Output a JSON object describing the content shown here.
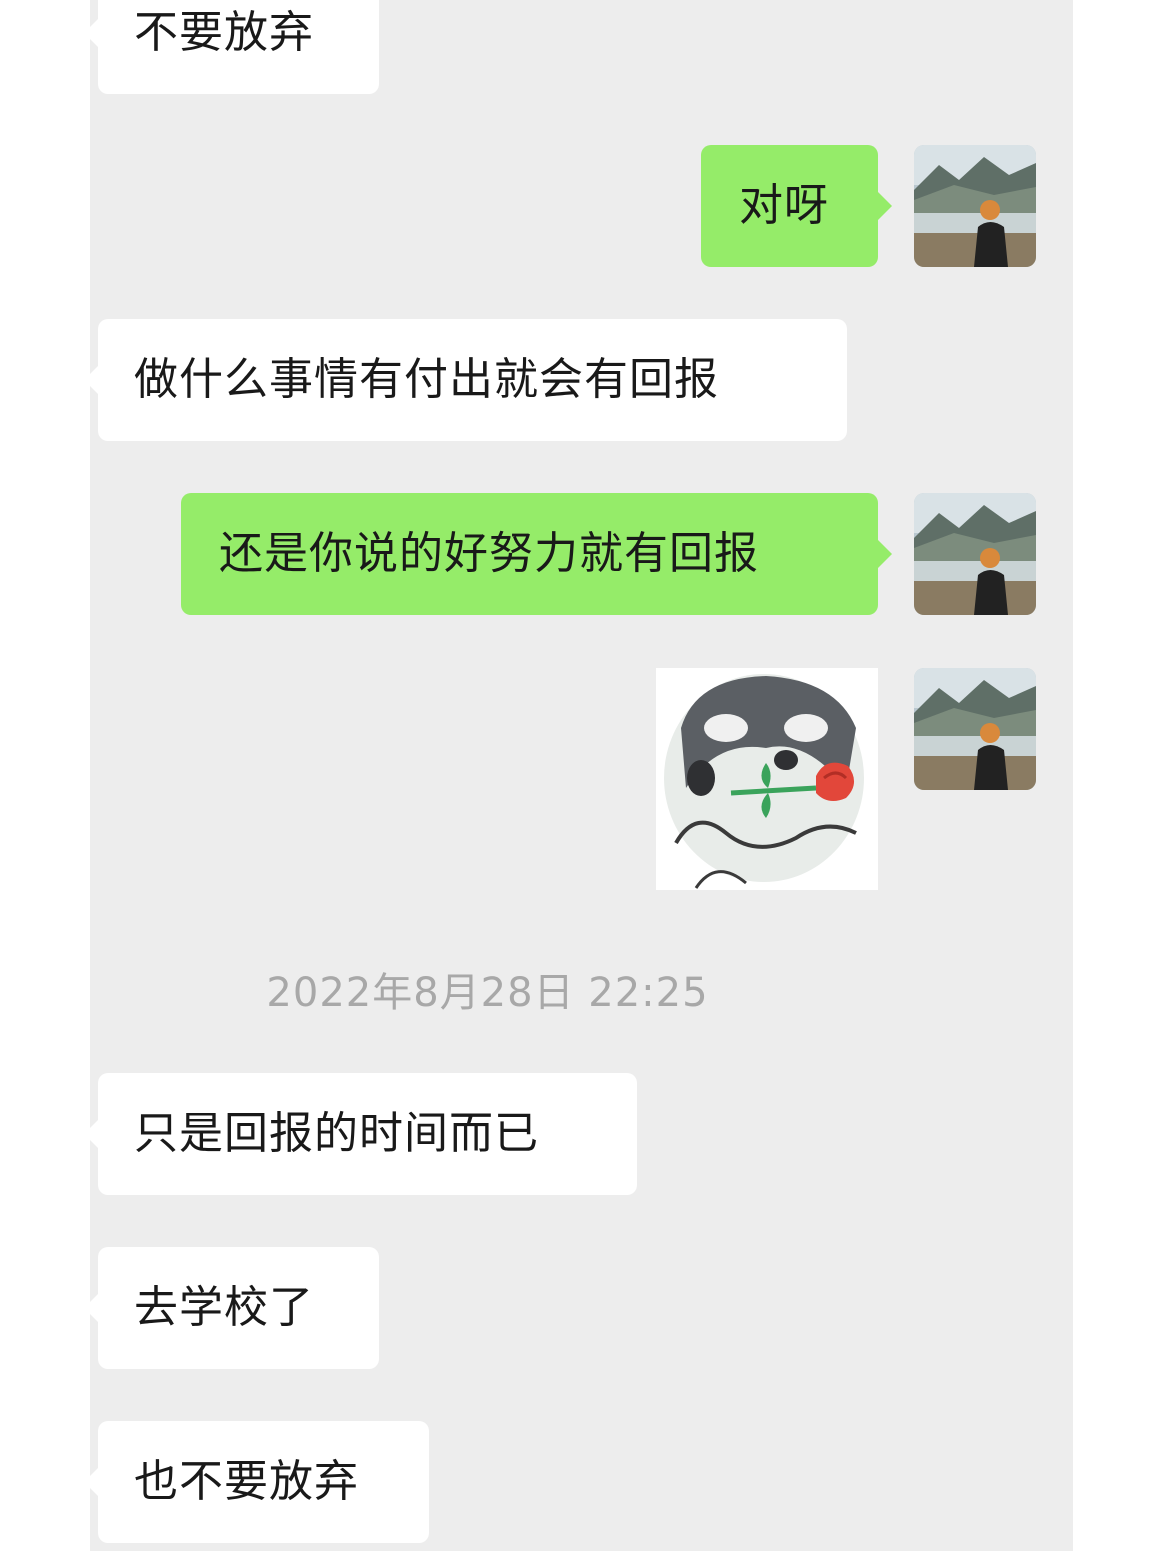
{
  "messages": [
    {
      "id": "m1",
      "side": "received",
      "text": "不要放弃"
    },
    {
      "id": "m2",
      "side": "sent",
      "text": "对呀"
    },
    {
      "id": "m3",
      "side": "received",
      "text": "做什么事情有付出就会有回报"
    },
    {
      "id": "m4",
      "side": "sent",
      "text": "还是你说的好努力就有回报"
    },
    {
      "id": "m5",
      "side": "sent",
      "type": "sticker",
      "sticker": "cat-with-rose"
    },
    {
      "id": "m6",
      "side": "received",
      "text": "只是回报的时间而已"
    },
    {
      "id": "m7",
      "side": "received",
      "text": "去学校了"
    },
    {
      "id": "m8",
      "side": "received",
      "text": "也不要放弃"
    }
  ],
  "timestamp": "2022年8月28日 22:25",
  "colors": {
    "background": "#ededed",
    "sent_bubble": "#95ec69",
    "received_bubble": "#ffffff",
    "timestamp_text": "#a8a8a8"
  },
  "avatar": {
    "icon": "landscape-photo-avatar"
  }
}
